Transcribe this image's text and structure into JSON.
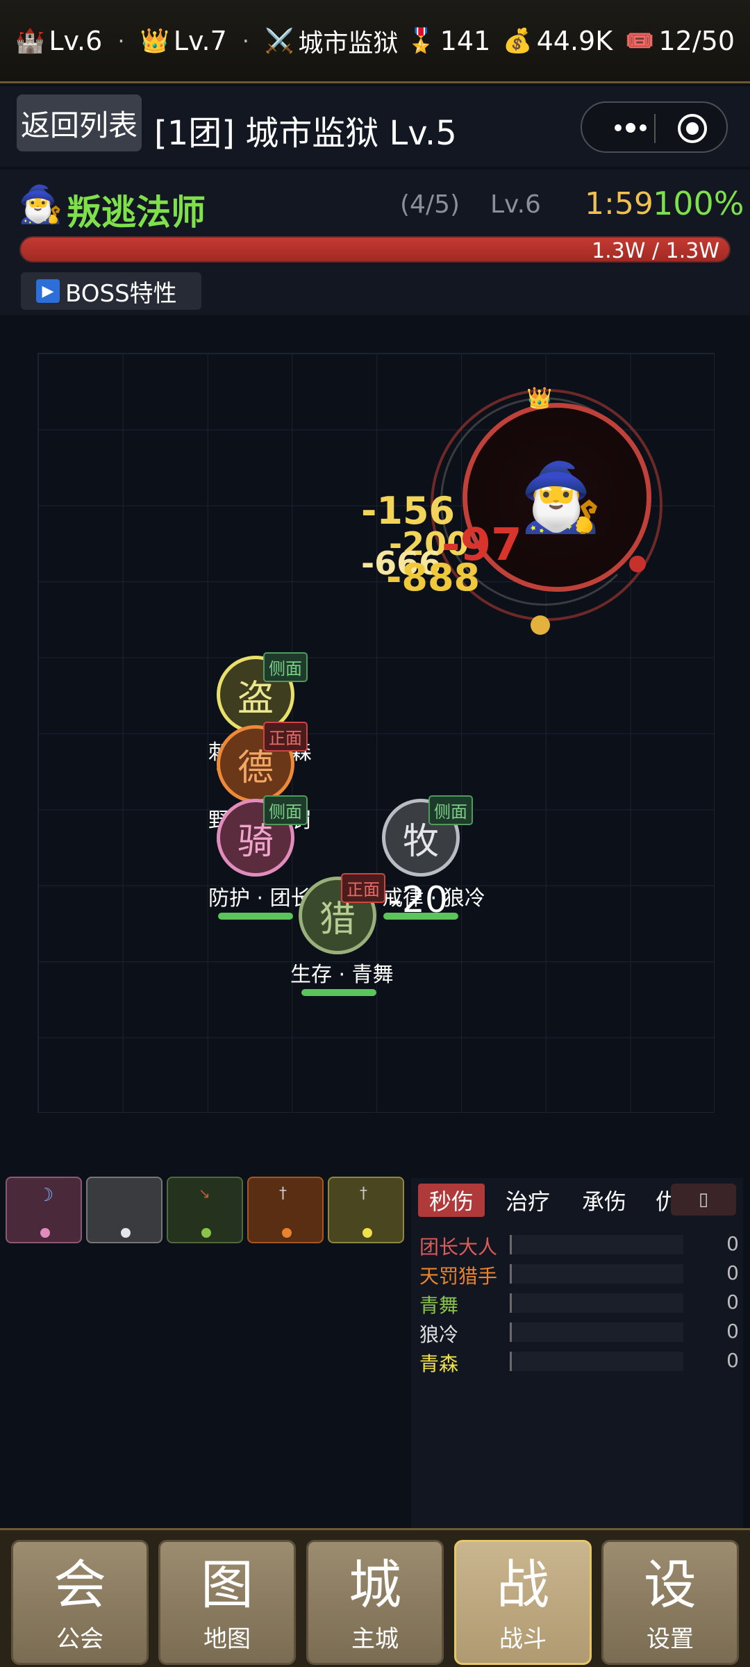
{
  "status": {
    "castle_level": "Lv.6",
    "crown_level": "Lv.7",
    "location": "城市监狱",
    "medals": "141",
    "gold": "44.9K",
    "tickets": "12/50",
    "dot": "·"
  },
  "title": {
    "back": "返回列表",
    "text": "[1团] 城市监狱 Lv.5"
  },
  "boss": {
    "name": "叛逃法师",
    "progress": "(4/5)",
    "level": "Lv.6",
    "timer": "1:59",
    "percent": "100%",
    "hp_text": "1.3W / 1.3W",
    "hp_fraction": 1.0,
    "trait_button": "BOSS特性"
  },
  "damage_numbers": [
    "-156",
    "-200",
    "-666",
    "-888",
    "-97"
  ],
  "heroes": [
    {
      "glyph": "盗",
      "tag": "侧面",
      "label": "刺杀 · 青森"
    },
    {
      "glyph": "德",
      "tag": "正面",
      "label": "野性 · 天罚"
    },
    {
      "glyph": "骑",
      "tag": "侧面",
      "label": "防护 · 团长"
    },
    {
      "glyph": "牧",
      "tag": "侧面",
      "label": "戒律 · 狼冷"
    },
    {
      "glyph": "猎",
      "tag": "正面",
      "label": "生存 · 青舞"
    }
  ],
  "heal_number": "-20",
  "stats": {
    "tabs": [
      "秒伤",
      "治疗",
      "承伤",
      "仇恨"
    ],
    "copy_icon": "copy-icon",
    "rows": [
      {
        "name": "团长大人",
        "value": "0",
        "color": "#e05a5a"
      },
      {
        "name": "天罚猎手",
        "value": "0",
        "color": "#e8842e"
      },
      {
        "name": "青舞",
        "value": "0",
        "color": "#8bc34a"
      },
      {
        "name": "狼冷",
        "value": "0",
        "color": "#e0e0e0"
      },
      {
        "name": "青森",
        "value": "0",
        "color": "#f0e04a"
      }
    ]
  },
  "nav": [
    {
      "big": "会",
      "small": "公会"
    },
    {
      "big": "图",
      "small": "地图"
    },
    {
      "big": "城",
      "small": "主城"
    },
    {
      "big": "战",
      "small": "战斗"
    },
    {
      "big": "设",
      "small": "设置"
    }
  ]
}
